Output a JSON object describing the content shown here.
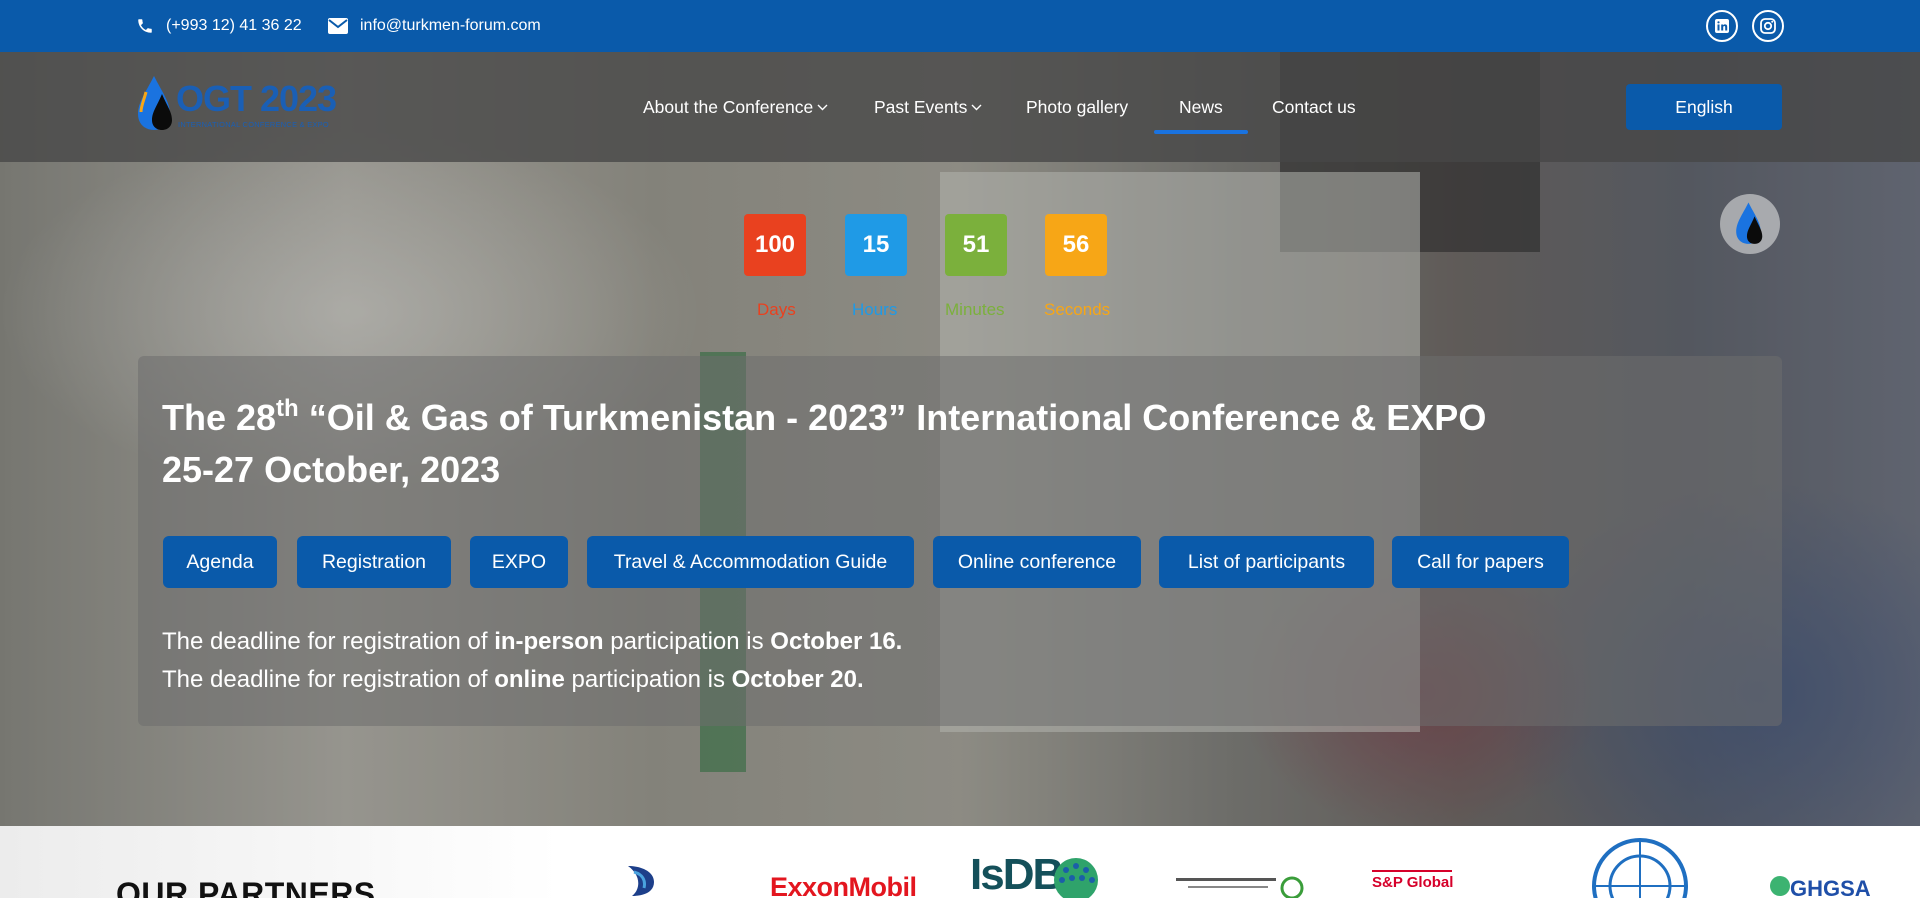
{
  "topbar": {
    "phone": "(+993 12) 41 36 22",
    "email": "info@turkmen-forum.com",
    "social": [
      "linkedin-icon",
      "instagram-icon"
    ]
  },
  "logo": {
    "name": "OGT 2023",
    "tagline": "INTERNATIONAL CONFERENCE & EXPO"
  },
  "nav": {
    "items": [
      {
        "label": "About the Conference",
        "dropdown": true
      },
      {
        "label": "Past Events",
        "dropdown": true
      },
      {
        "label": "Photo gallery",
        "dropdown": false
      },
      {
        "label": "News",
        "dropdown": false,
        "active": true
      },
      {
        "label": "Contact us",
        "dropdown": false
      }
    ],
    "language": "English"
  },
  "countdown": {
    "days": {
      "value": "100",
      "label": "Days"
    },
    "hours": {
      "value": "15",
      "label": "Hours"
    },
    "minutes": {
      "value": "51",
      "label": "Minutes"
    },
    "seconds": {
      "value": "56",
      "label": "Seconds"
    }
  },
  "hero": {
    "title_prefix": "The 28",
    "title_sup": "th",
    "title_rest": " “Oil & Gas of Turkmenistan - 2023” International Conference & EXPO",
    "dates": "25-27 October, 2023",
    "buttons": [
      "Agenda",
      "Registration",
      "EXPO",
      "Travel & Accommodation Guide",
      "Online conference",
      "List of participants",
      "Call for papers"
    ],
    "deadline1": {
      "pre": "The deadline for registration of ",
      "mode": "in-person",
      "mid": " participation is ",
      "date": "October 16."
    },
    "deadline2": {
      "pre": "The deadline for registration of ",
      "mode": "online",
      "mid": " participation is ",
      "date": "October 20."
    }
  },
  "partners": {
    "title": "OUR PARTNERS",
    "logos": [
      "ExxonMobil",
      "IsDB",
      "S&P Global",
      "GHGSA"
    ]
  },
  "colors": {
    "brand_blue": "#0a5aaa",
    "days": "#e9411f",
    "hours": "#1f9ae6",
    "minutes": "#7bb03c",
    "seconds": "#f7a616"
  }
}
